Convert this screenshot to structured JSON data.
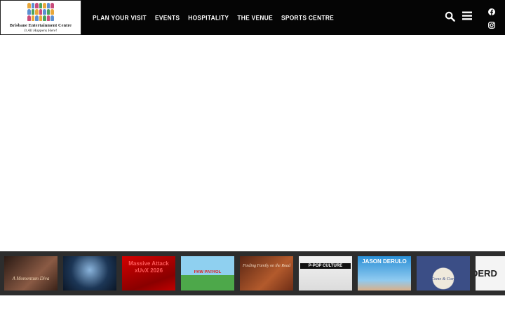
{
  "brand": {
    "name": "Brisbane Entertainment Centre",
    "tagline": "It All Happens Here!"
  },
  "nav": {
    "items": [
      {
        "label": "PLAN YOUR VISIT"
      },
      {
        "label": "EVENTS"
      },
      {
        "label": "HOSPITALITY"
      },
      {
        "label": "THE VENUE"
      },
      {
        "label": "SPORTS CENTRE"
      }
    ]
  },
  "icons": {
    "search": "search-icon",
    "menu": "hamburger-menu-icon",
    "facebook": "facebook-icon",
    "instagram": "instagram-icon"
  },
  "events": [
    {
      "text": "A Momentum Diva",
      "colors": [
        "#2a1a14",
        "#7a4a38"
      ]
    },
    {
      "text": "",
      "colors": [
        "#0d1a2e",
        "#3b5f86"
      ]
    },
    {
      "text": "Massive Attack xUvX 2026",
      "colors": [
        "#b80000",
        "#e01515"
      ]
    },
    {
      "text": "PAW PATROL",
      "colors": [
        "#7cc3e8",
        "#3f9a3a"
      ]
    },
    {
      "text": "Finding Family on the Road",
      "colors": [
        "#5a2614",
        "#a24a24"
      ]
    },
    {
      "text": "P-POP CULTURE",
      "colors": [
        "#f2f2f2",
        "#bdbdbd"
      ]
    },
    {
      "text": "JASON DERULO",
      "colors": [
        "#2a8fd6",
        "#9bd0f2"
      ]
    },
    {
      "text": "Come & Cozy",
      "colors": [
        "#3b4e86",
        "#e9e4d8"
      ]
    },
    {
      "text": "DERD",
      "colors": [
        "#f4f4f4",
        "#d9d9d9"
      ]
    }
  ],
  "colors": {
    "header_bg": "#050505",
    "strip_bg": "#2d2d2d",
    "nav_text": "#ffffff"
  }
}
